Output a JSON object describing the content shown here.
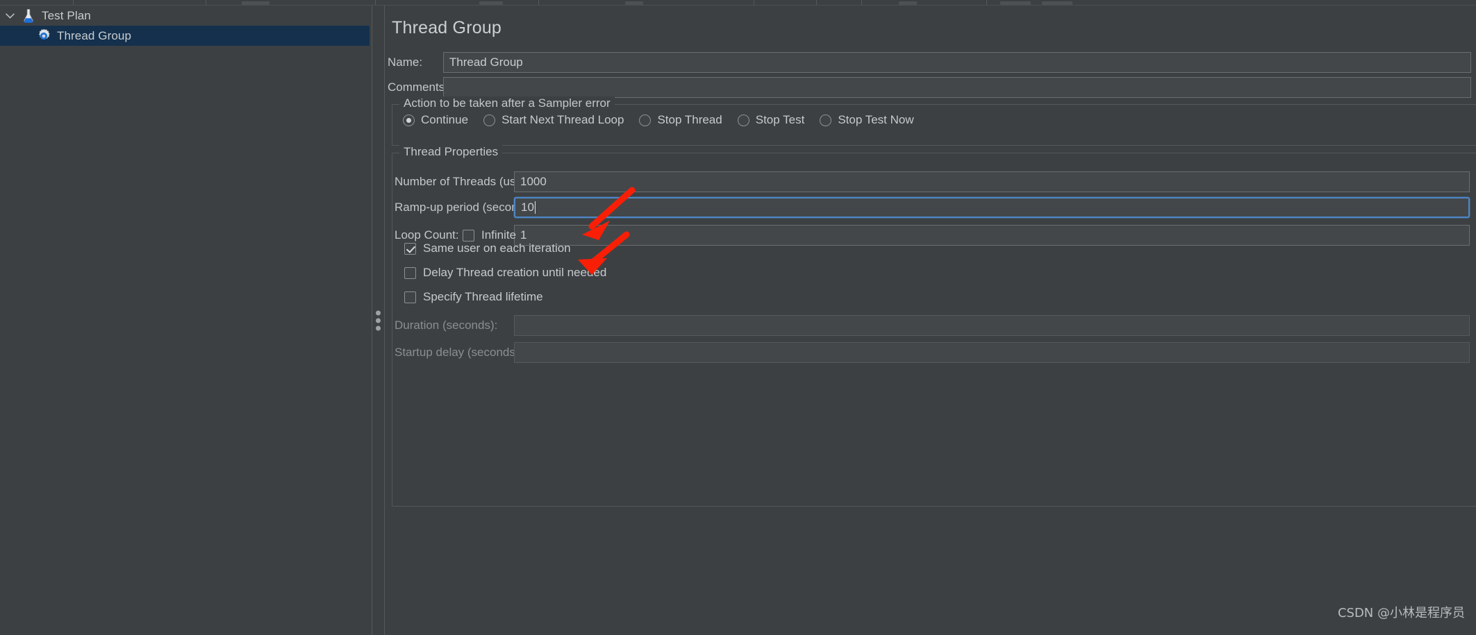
{
  "window": {
    "editor_title": "Thread Group"
  },
  "tree": {
    "items": [
      {
        "label": "Test Plan",
        "icon": "test-plan-flask-icon",
        "selected": false,
        "depth": 0,
        "expander": "chevron-down-icon"
      },
      {
        "label": "Thread Group",
        "icon": "thread-group-gear-icon",
        "selected": true,
        "depth": 1,
        "expander": ""
      }
    ]
  },
  "form": {
    "name_label": "Name:",
    "name_value": "Thread Group",
    "comments_label": "Comments:",
    "comments_value": "",
    "comments_placeholder": ""
  },
  "sampler_error": {
    "group_title": "Action to be taken after a Sampler error",
    "options": [
      {
        "label": "Continue",
        "checked": true
      },
      {
        "label": "Start Next Thread Loop",
        "checked": false
      },
      {
        "label": "Stop Thread",
        "checked": false
      },
      {
        "label": "Stop Test",
        "checked": false
      },
      {
        "label": "Stop Test Now",
        "checked": false
      }
    ]
  },
  "thread_properties": {
    "group_title": "Thread Properties",
    "num_threads_label": "Number of Threads (users):",
    "num_threads_value": "1000",
    "ramp_up_label": "Ramp-up period (seconds):",
    "ramp_up_value": "10",
    "loop_count_label": "Loop Count:",
    "infinite_label": "Infinite",
    "infinite_checked": false,
    "loop_count_value": "1",
    "same_user_label": "Same user on each iteration",
    "same_user_checked": true,
    "delay_thread_label": "Delay Thread creation until needed",
    "delay_thread_checked": false,
    "specify_lifetime_label": "Specify Thread lifetime",
    "specify_lifetime_checked": false,
    "duration_label": "Duration (seconds):",
    "duration_value": "",
    "startup_delay_label": "Startup delay (seconds):",
    "startup_delay_value": ""
  },
  "annotations": {
    "arrow_color": "#f81f06",
    "arrow_count": 2,
    "arrow_target_1": "num_threads_value",
    "arrow_target_2": "ramp_up_value"
  },
  "watermark": {
    "text": "CSDN @小林是程序员"
  },
  "colors": {
    "background": "#3c4043",
    "panel": "#3c4043",
    "selection": "#14304d",
    "focus_border": "#4d87c7",
    "text": "#c8cbcd",
    "text_disabled": "#8a8e91",
    "border": "#55595c",
    "field_border": "#6a6e71"
  }
}
